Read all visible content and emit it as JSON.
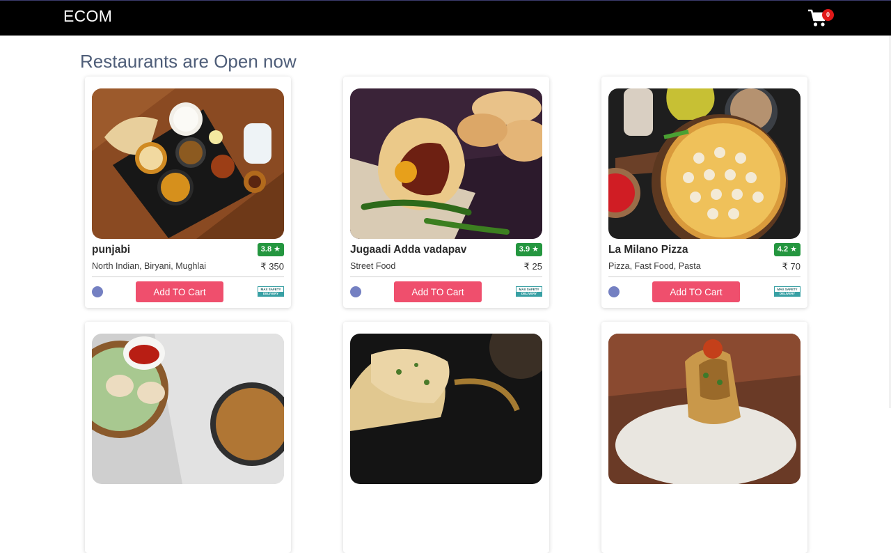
{
  "header": {
    "brand": "ECOM",
    "cart_count": "0"
  },
  "page": {
    "heading": "Restaurants are Open now"
  },
  "cards": [
    {
      "name": "punjabi",
      "rating": "3.8 ★",
      "cuisine": "North Indian, Biryani, Mughlai",
      "price": "₹ 350",
      "button": "Add TO Cart",
      "badge_line1": "MAX SAFETY",
      "badge_line2": "DELIVERY"
    },
    {
      "name": "Jugaadi Adda vadapav",
      "rating": "3.9 ★",
      "cuisine": "Street Food",
      "price": "₹ 25",
      "button": "Add TO Cart",
      "badge_line1": "MAX SAFETY",
      "badge_line2": "DELIVERY"
    },
    {
      "name": "La Milano Pizza",
      "rating": "4.2 ★",
      "cuisine": "Pizza, Fast Food, Pasta",
      "price": "₹ 70",
      "button": "Add TO Cart",
      "badge_line1": "MAX SAFETY",
      "badge_line2": "DELIVERY"
    },
    {
      "name": "",
      "rating": "",
      "cuisine": "",
      "price": "",
      "button": "",
      "badge_line1": "",
      "badge_line2": ""
    },
    {
      "name": "",
      "rating": "",
      "cuisine": "",
      "price": "",
      "button": "",
      "badge_line1": "",
      "badge_line2": ""
    },
    {
      "name": "",
      "rating": "",
      "cuisine": "",
      "price": "",
      "button": "",
      "badge_line1": "",
      "badge_line2": ""
    }
  ],
  "colors": {
    "header_bg": "#000000",
    "rating_green": "#24963f",
    "button_pink": "#ef4f6d",
    "cart_badge": "#e11919"
  }
}
